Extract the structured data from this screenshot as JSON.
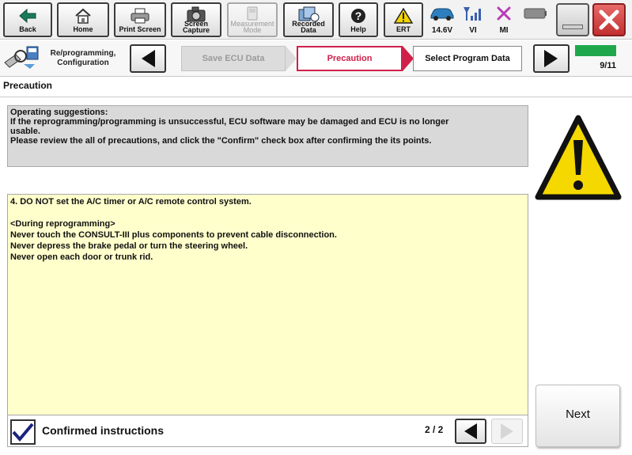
{
  "toolbar": {
    "back_label": "Back",
    "home_label": "Home",
    "print_label": "Print Screen",
    "capture_label_1": "Screen",
    "capture_label_2": "Capture",
    "measurement_label_1": "Measurement",
    "measurement_label_2": "Mode",
    "recorded_label_1": "Recorded",
    "recorded_label_2": "Data",
    "help_label": "Help",
    "ert_label": "ERT",
    "voltage": "14.6V",
    "vi_label": "VI",
    "mi_label": "MI"
  },
  "icons": {
    "back": "back-arrow-icon",
    "home": "home-icon",
    "print": "printer-icon",
    "capture": "camera-icon",
    "measurement": "measurement-icon",
    "recorded": "recorded-data-icon",
    "help": "question-icon",
    "ert": "warning-triangle-icon",
    "car": "car-icon",
    "vi": "signal-icon",
    "mi": "x-mark-icon",
    "battery": "battery-icon"
  },
  "nav": {
    "mode_label_1": "Re/programming,",
    "mode_label_2": "Configuration",
    "steps": [
      {
        "label": "Save ECU Data",
        "state": "disabled"
      },
      {
        "label": "Precaution",
        "state": "current"
      },
      {
        "label": "Select Program Data",
        "state": "next"
      }
    ],
    "progress": "9/11",
    "progress_fraction": 0.818
  },
  "page": {
    "title": "Precaution"
  },
  "suggestions": {
    "lines": [
      "Operating  suggestions:",
      "If the reprogramming/programming is unsuccessful, ECU software may be damaged and ECU is no longer",
      "usable.",
      "Please review the all of precautions, and click the \"Confirm\" check box after confirming the its points."
    ]
  },
  "instructions": {
    "line1": "4. DO NOT set the A/C timer or A/C remote control system.",
    "line2": "<During  reprogramming>",
    "line3": "Never touch the CONSULT-III plus components to prevent cable disconnection.",
    "line4": "Never depress the brake pedal or turn the steering wheel.",
    "line5": "Never open each door or trunk rid."
  },
  "bottom": {
    "confirm_label": "Confirmed instructions",
    "confirmed": true,
    "page_counter": "2 / 2"
  },
  "next_label": "Next",
  "colors": {
    "current_step": "#d0204a",
    "progress": "#1fa84b",
    "instructions_bg": "#ffffcc",
    "suggestions_bg": "#d9d9d9",
    "close_button": "#c0302f",
    "check_mark": "#1a237e"
  }
}
